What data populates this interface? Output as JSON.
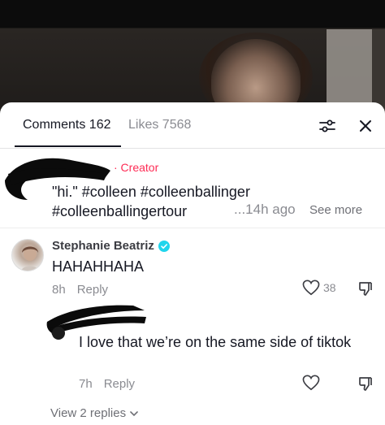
{
  "video": {
    "description_hidden": ""
  },
  "tabs": {
    "comments_label": "Comments 162",
    "likes_label": "Likes 7568"
  },
  "icons": {
    "filter": "sliders-icon",
    "close": "close-icon",
    "like": "heart-icon",
    "dislike": "thumbs-down-icon",
    "verified": "verified-badge-icon",
    "chevron": "chevron-down-icon"
  },
  "colors": {
    "accent": "#fe2c55",
    "verified": "#20d5ec",
    "muted": "#8a8b91"
  },
  "comments": [
    {
      "role_tag": "· Creator",
      "text": "\"hi.\" #colleen #colleenballinger #colleenballingertour",
      "time": "...14h ago",
      "see_more": "See more"
    },
    {
      "username": "Stephanie Beatriz",
      "text": "HAHAHHAHA",
      "time": "8h",
      "reply_label": "Reply",
      "like_count": "38",
      "replies": [
        {
          "text": "I love that we’re on the same side of tiktok",
          "time": "7h",
          "reply_label": "Reply"
        }
      ],
      "view_replies_label": "View 2 replies"
    }
  ]
}
